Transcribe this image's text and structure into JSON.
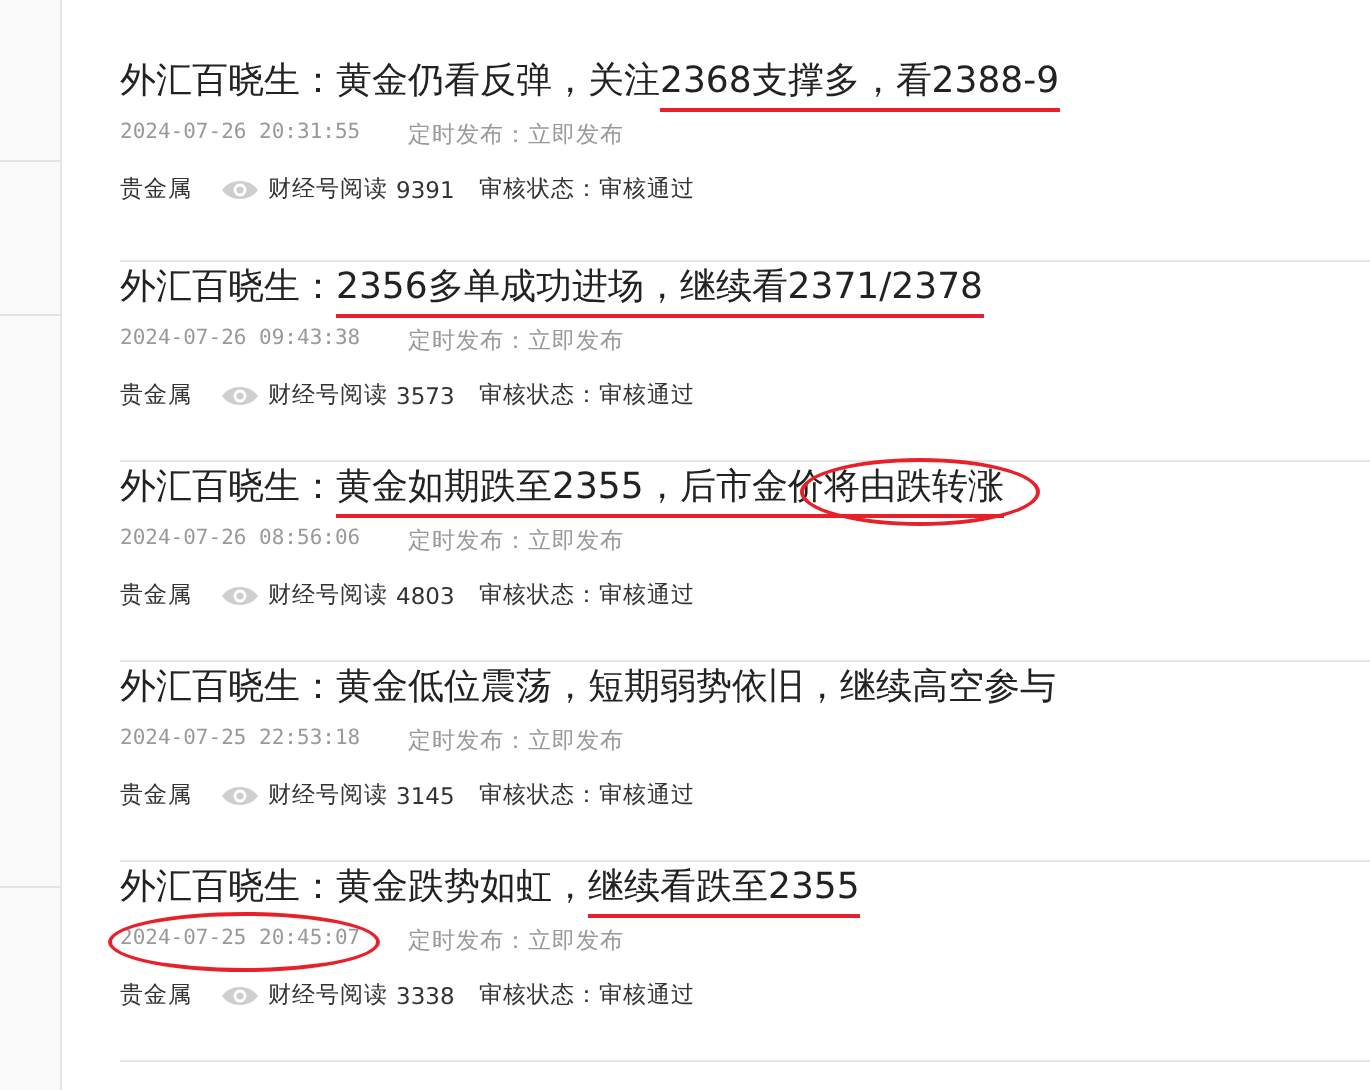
{
  "articles": [
    {
      "title_segments": [
        {
          "text": "外汇百晓生：黄金仍看反弹，关注",
          "underlined": false,
          "circled": false
        },
        {
          "text": "2368支撑多，看2388-9",
          "underlined": true,
          "circled": false
        }
      ],
      "datetime": "2024-07-26 20:31:55",
      "datetime_circled": false,
      "schedule_label": "定时发布：",
      "schedule_value": "立即发布",
      "category": "贵金属",
      "reads_label": "财经号阅读",
      "reads": "9391",
      "review_label": "审核状态：",
      "review_value": "审核通过"
    },
    {
      "title_segments": [
        {
          "text": "外汇百晓生：",
          "underlined": false,
          "circled": false
        },
        {
          "text": "2356多单成功进场，继续看2371/2378",
          "underlined": true,
          "circled": false
        }
      ],
      "datetime": "2024-07-26 09:43:38",
      "datetime_circled": false,
      "schedule_label": "定时发布：",
      "schedule_value": "立即发布",
      "category": "贵金属",
      "reads_label": "财经号阅读",
      "reads": "3573",
      "review_label": "审核状态：",
      "review_value": "审核通过"
    },
    {
      "title_segments": [
        {
          "text": "外汇百晓生：",
          "underlined": false,
          "circled": false
        },
        {
          "text": "黄金如期跌至2355，后市金价",
          "underlined": true,
          "circled": false
        },
        {
          "text": "将由跌转涨",
          "underlined": true,
          "circled": true
        }
      ],
      "datetime": "2024-07-26 08:56:06",
      "datetime_circled": false,
      "schedule_label": "定时发布：",
      "schedule_value": "立即发布",
      "category": "贵金属",
      "reads_label": "财经号阅读",
      "reads": "4803",
      "review_label": "审核状态：",
      "review_value": "审核通过"
    },
    {
      "title_segments": [
        {
          "text": "外汇百晓生：黄金低位震荡，短期弱势依旧，继续高空参与",
          "underlined": false,
          "circled": false
        }
      ],
      "datetime": "2024-07-25 22:53:18",
      "datetime_circled": false,
      "schedule_label": "定时发布：",
      "schedule_value": "立即发布",
      "category": "贵金属",
      "reads_label": "财经号阅读",
      "reads": "3145",
      "review_label": "审核状态：",
      "review_value": "审核通过"
    },
    {
      "title_segments": [
        {
          "text": "外汇百晓生：黄金跌势如虹，",
          "underlined": false,
          "circled": false
        },
        {
          "text": "继续看跌至2355",
          "underlined": true,
          "circled": false
        }
      ],
      "datetime": "2024-07-25 20:45:07",
      "datetime_circled": true,
      "schedule_label": "定时发布：",
      "schedule_value": "立即发布",
      "category": "贵金属",
      "reads_label": "财经号阅读",
      "reads": "3338",
      "review_label": "审核状态：",
      "review_value": "审核通过"
    }
  ]
}
